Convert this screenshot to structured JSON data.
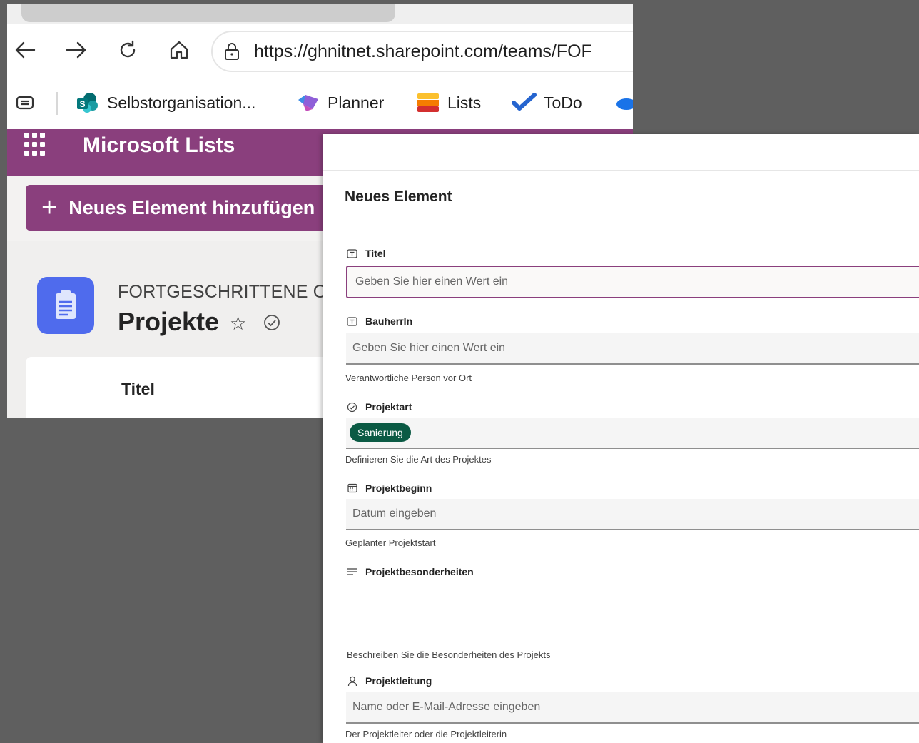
{
  "browser": {
    "url": "https://ghnitnet.sharepoint.com/teams/FOF",
    "bookmarks": [
      {
        "label": "Selbstorganisation..."
      },
      {
        "label": "Planner"
      },
      {
        "label": "Lists"
      },
      {
        "label": "ToDo"
      }
    ]
  },
  "app": {
    "title": "Microsoft Lists",
    "new_item_label": "Neues Element hinzufügen",
    "site_name": "FORTGESCHRITTENE ORG/",
    "list_name": "Projekte",
    "column_header": "Titel"
  },
  "panel": {
    "title": "Neues Element",
    "fields": [
      {
        "label": "Titel",
        "placeholder": "Geben Sie hier einen Wert ein",
        "help": ""
      },
      {
        "label": "BauherrIn",
        "placeholder": "Geben Sie hier einen Wert ein",
        "help": "Verantwortliche Person vor Ort"
      },
      {
        "label": "Projektart",
        "value": "Sanierung",
        "help": "Definieren Sie die Art des Projektes"
      },
      {
        "label": "Projektbeginn",
        "placeholder": "Datum eingeben",
        "help": "Geplanter Projektstart"
      },
      {
        "label": "Projektbesonderheiten",
        "help": "Beschreiben Sie die Besonderheiten des Projekts"
      },
      {
        "label": "Projektleitung",
        "placeholder": "Name oder E-Mail-Adresse eingeben",
        "help": "Der Projektleiter oder die Projektleiterin"
      }
    ],
    "accent_color": "#8a3f7d",
    "chip_color": "#0b5a44"
  }
}
